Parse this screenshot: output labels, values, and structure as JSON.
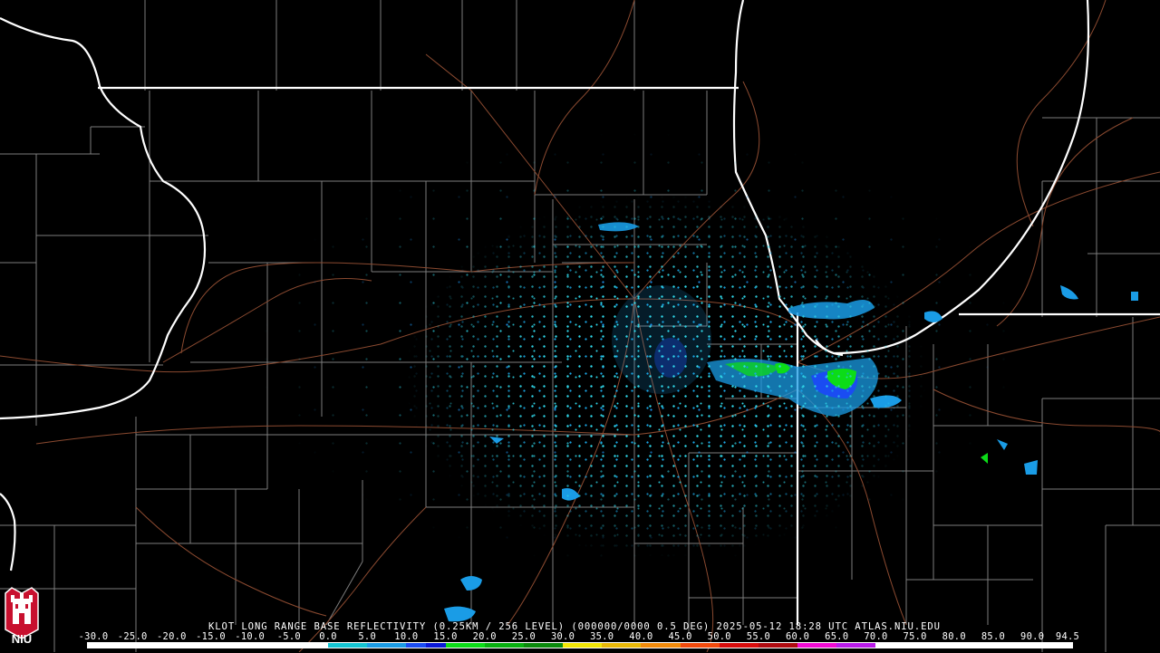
{
  "header": {
    "product": "KLOT LONG RANGE BASE REFLECTIVITY",
    "resolution": "(0.25KM / 256 LEVEL)",
    "volume": "(000000/0000",
    "elevation": "0.5 DEG)",
    "timestamp": "2025-05-12 18:28 UTC",
    "source": "ATLAS.NIU.EDU"
  },
  "logo": {
    "text": "NIU",
    "icon": "niu-castle-logo-icon",
    "color": "#c8102e"
  },
  "colors": {
    "background": "#000000",
    "state_border": "#ffffff",
    "county_border": "#8a8a8a",
    "highway": "#8a4a2e",
    "lake_shore": "#ffffff"
  },
  "reflectivity_scale": {
    "unit_label": "",
    "ticks": [
      "-30.0",
      "-25.0",
      "-20.0",
      "-15.0",
      "-10.0",
      "-5.0",
      "0.0",
      "5.0",
      "10.0",
      "15.0",
      "20.0",
      "25.0",
      "30.0",
      "35.0",
      "40.0",
      "45.0",
      "50.0",
      "55.0",
      "60.0",
      "65.0",
      "70.0",
      "75.0",
      "80.0",
      "85.0",
      "90.0",
      "94.5"
    ],
    "stops": [
      {
        "from": -30,
        "color": "#ffffff"
      },
      {
        "from": 0,
        "color": "#14c4d2"
      },
      {
        "from": 5,
        "color": "#1a9ce6"
      },
      {
        "from": 10,
        "color": "#1a4cf2"
      },
      {
        "from": 12.5,
        "color": "#0a18d8"
      },
      {
        "from": 15,
        "color": "#0cdc18"
      },
      {
        "from": 20,
        "color": "#08b010"
      },
      {
        "from": 25,
        "color": "#0a8a0c"
      },
      {
        "from": 30,
        "color": "#f2e606"
      },
      {
        "from": 35,
        "color": "#e8b808"
      },
      {
        "from": 40,
        "color": "#f28a0a"
      },
      {
        "from": 45,
        "color": "#f24a0c"
      },
      {
        "from": 50,
        "color": "#d80c0c"
      },
      {
        "from": 55,
        "color": "#b00a10"
      },
      {
        "from": 60,
        "color": "#f00ad2"
      },
      {
        "from": 65,
        "color": "#b81ae8"
      },
      {
        "from": 70,
        "color": "#ffffff"
      }
    ]
  }
}
